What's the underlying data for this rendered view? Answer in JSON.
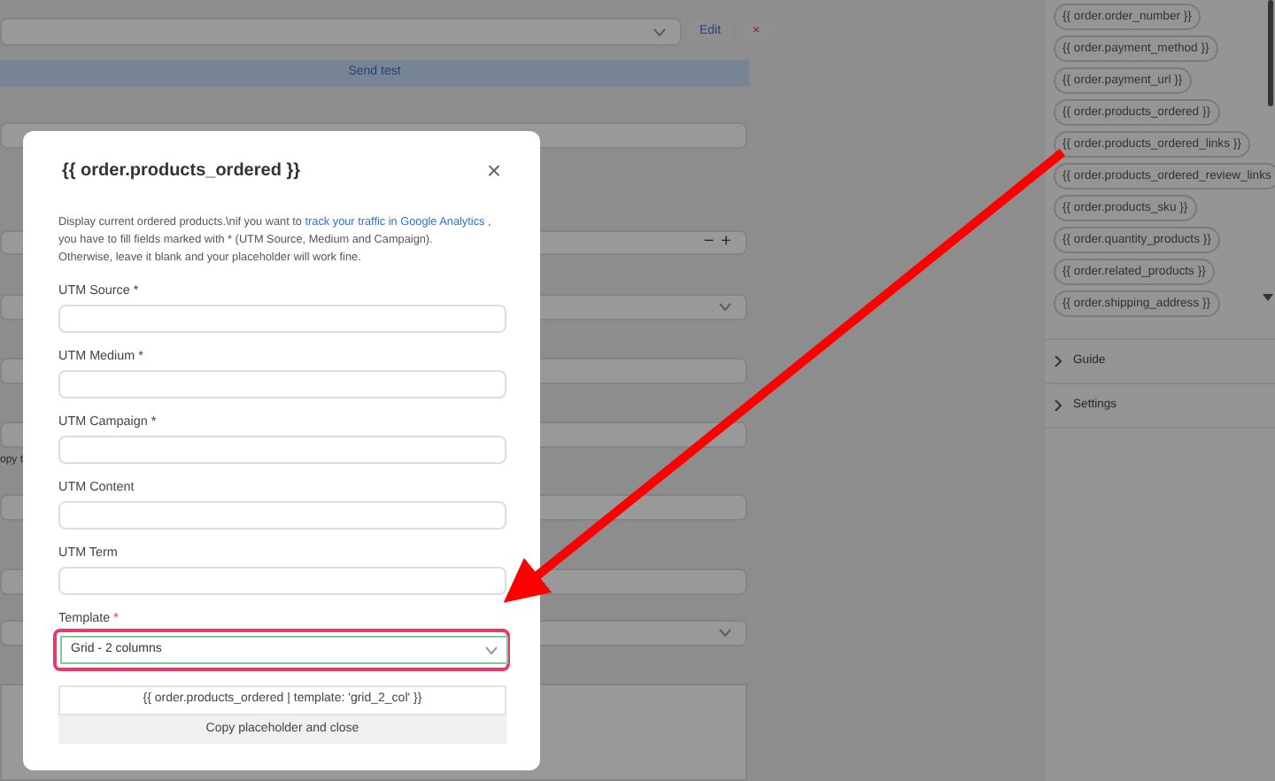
{
  "background": {
    "template_select_buttons": [
      "Edit",
      "×"
    ],
    "send_test": "Send test",
    "stepper": [
      "−",
      "+"
    ],
    "cut_text": "opy t"
  },
  "sidebar": {
    "placeholders": [
      "{{ order.order_number }}",
      "{{ order.payment_method }}",
      "{{ order.payment_url }}",
      "{{ order.products_ordered }}",
      "{{ order.products_ordered_links }}",
      "{{ order.products_ordered_review_links",
      "{{ order.products_sku }}",
      "{{ order.quantity_products }}",
      "{{ order.related_products }}",
      "{{ order.shipping_address }}"
    ],
    "sections": [
      {
        "label": "Guide",
        "expanded": false
      },
      {
        "label": "Settings",
        "expanded": false
      }
    ]
  },
  "modal": {
    "title": "{{ order.products_ordered }}",
    "close": "×",
    "description": {
      "intro": "Display current ordered products.\\nif you want to ",
      "link": "track your traffic in Google Analytics",
      "rest": [
        " ,",
        "you have to fill fields marked with * (UTM Source, Medium and Campaign).",
        "Otherwise, leave it blank and your placeholder will work fine."
      ]
    },
    "fields": [
      {
        "label": "UTM Source",
        "required_mark": "*"
      },
      {
        "label": "UTM Medium",
        "required_mark": "*"
      },
      {
        "label": "UTM Campaign",
        "required_mark": "*"
      },
      {
        "label": "UTM Content"
      },
      {
        "label": "UTM Term"
      }
    ],
    "template": {
      "label": "Template",
      "required_mark": "*",
      "value": "Grid - 2 columns",
      "highlighted": true
    },
    "preview": "{{ order.products_ordered | template: 'grid_2_col' }}",
    "copy_button": "Copy placeholder and close"
  }
}
